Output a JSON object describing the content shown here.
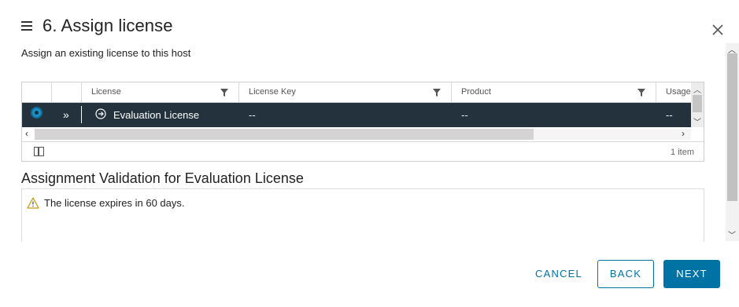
{
  "dialog": {
    "title": "6. Assign license",
    "subtitle": "Assign an existing license to this host"
  },
  "grid": {
    "columns": [
      {
        "label": "License"
      },
      {
        "label": "License Key"
      },
      {
        "label": "Product"
      },
      {
        "label": "Usage"
      }
    ],
    "rows": [
      {
        "license": "Evaluation License",
        "license_key": "--",
        "product": "--",
        "usage": "--",
        "selected": true
      }
    ],
    "footer": {
      "item_count": "1 item"
    }
  },
  "validation": {
    "title": "Assignment Validation for Evaluation License",
    "messages": [
      {
        "icon": "warning-icon",
        "text": "The license expires in 60 days."
      }
    ]
  },
  "buttons": {
    "cancel": "CANCEL",
    "back": "BACK",
    "next": "NEXT"
  },
  "colors": {
    "accent": "#0072a3",
    "selected_row": "#23323c",
    "warning": "#c99a1a"
  }
}
